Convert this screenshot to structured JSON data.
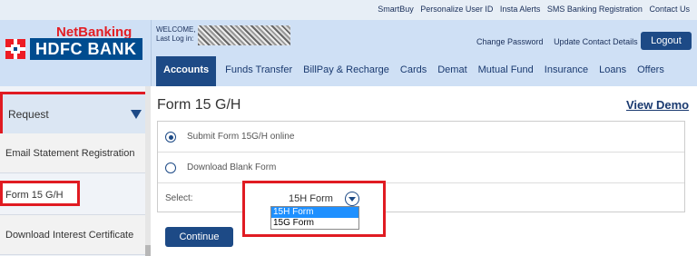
{
  "util_links": [
    "SmartBuy",
    "Personalize User ID",
    "Insta Alerts",
    "SMS Banking Registration",
    "Contact Us"
  ],
  "brand": {
    "netbanking": "NetBanking",
    "bank_name": "HDFC BANK"
  },
  "welcome": {
    "line1": "WELCOME,",
    "line2": "Last Log in:"
  },
  "header_links": [
    "Change Password",
    "Update Contact Details"
  ],
  "logout_label": "Logout",
  "tabs": [
    "Accounts",
    "Funds Transfer",
    "BillPay & Recharge",
    "Cards",
    "Demat",
    "Mutual Fund",
    "Insurance",
    "Loans",
    "Offers"
  ],
  "sidebar": {
    "request_label": "Request",
    "items": [
      "Email Statement Registration",
      "Form 15 G/H",
      "Download Interest Certificate"
    ]
  },
  "main": {
    "title": "Form 15 G/H",
    "view_demo": "View Demo",
    "options": [
      "Submit Form 15G/H online",
      "Download Blank Form"
    ],
    "select_label": "Select:",
    "select_value": "15H Form",
    "dropdown_options": [
      "15H Form",
      "15G Form"
    ],
    "continue_label": "Continue"
  },
  "colors": {
    "brand_red": "#e31e24",
    "brand_blue": "#1d4a86",
    "highlight_red": "#e01b22"
  }
}
